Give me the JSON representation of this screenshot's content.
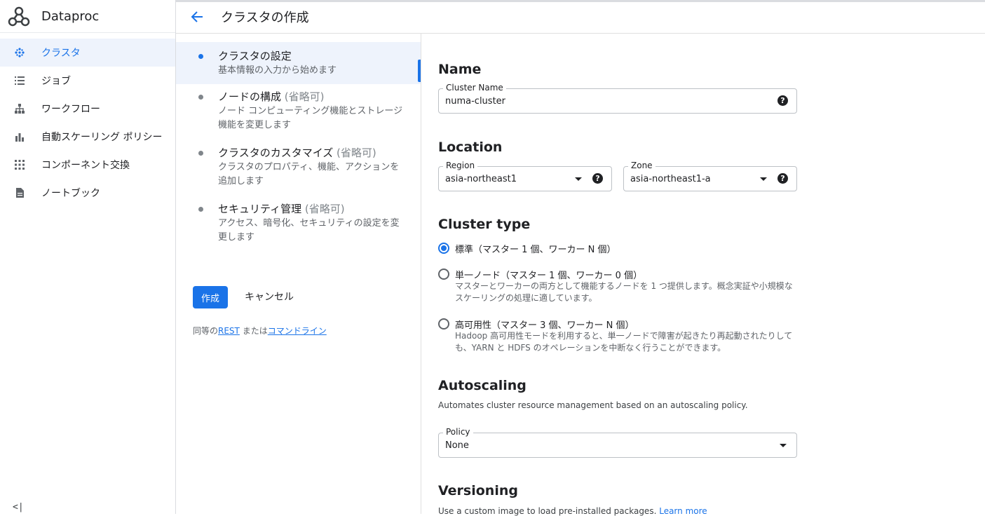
{
  "app": {
    "name": "Dataproc"
  },
  "sidebar": {
    "items": [
      {
        "label": "クラスタ",
        "icon": "clusters-icon",
        "active": true
      },
      {
        "label": "ジョブ",
        "icon": "list-icon"
      },
      {
        "label": "ワークフロー",
        "icon": "workflow-icon"
      },
      {
        "label": "自動スケーリング ポリシー",
        "icon": "bar-chart-icon"
      },
      {
        "label": "コンポーネント交換",
        "icon": "grid-icon"
      },
      {
        "label": "ノートブック",
        "icon": "document-icon"
      }
    ],
    "collapse_label": "<|"
  },
  "header": {
    "title": "クラスタの作成"
  },
  "steps": [
    {
      "title": "クラスタの設定",
      "optional": "",
      "desc": "基本情報の入力から始めます"
    },
    {
      "title": "ノードの構成",
      "optional": "(省略可)",
      "desc": "ノード コンピューティング機能とストレージ機能を変更します"
    },
    {
      "title": "クラスタのカスタマイズ",
      "optional": "(省略可)",
      "desc": "クラスタのプロパティ、機能、アクションを追加します"
    },
    {
      "title": "セキュリティ管理",
      "optional": "(省略可)",
      "desc": "アクセス、暗号化、セキュリティの設定を変更します"
    }
  ],
  "actions": {
    "create": "作成",
    "cancel": "キャンセル"
  },
  "equivalent": {
    "prefix": "同等の",
    "rest": "REST",
    "middle": "または",
    "cli": "コマンドライン"
  },
  "form": {
    "name": {
      "title": "Name",
      "label": "Cluster Name",
      "value": "numa-cluster"
    },
    "location": {
      "title": "Location",
      "region_label": "Region",
      "region_value": "asia-northeast1",
      "zone_label": "Zone",
      "zone_value": "asia-northeast1-a"
    },
    "cluster_type": {
      "title": "Cluster type",
      "options": [
        {
          "label": "標準（マスター 1 個、ワーカー N 個）",
          "desc": "",
          "checked": true
        },
        {
          "label": "単一ノード（マスター 1 個、ワーカー 0 個）",
          "desc": "マスターとワーカーの両方として機能するノードを 1 つ提供します。概念実証や小規模なスケーリングの処理に適しています。",
          "checked": false
        },
        {
          "label": "高可用性（マスター 3 個、ワーカー N 個）",
          "desc": "Hadoop 高可用性モードを利用すると、単一ノードで障害が起きたり再起動されたりしても、YARN と HDFS のオペレーションを中断なく行うことができます。",
          "checked": false
        }
      ]
    },
    "autoscaling": {
      "title": "Autoscaling",
      "desc": "Automates cluster resource management based on an autoscaling policy.",
      "policy_label": "Policy",
      "policy_value": "None"
    },
    "versioning": {
      "title": "Versioning",
      "desc": "Use a custom image to load pre-installed packages.",
      "learn_more": "Learn more"
    },
    "help_glyph": "?"
  },
  "colors": {
    "accent": "#1a73e8",
    "active_bg": "#eef3fc"
  }
}
